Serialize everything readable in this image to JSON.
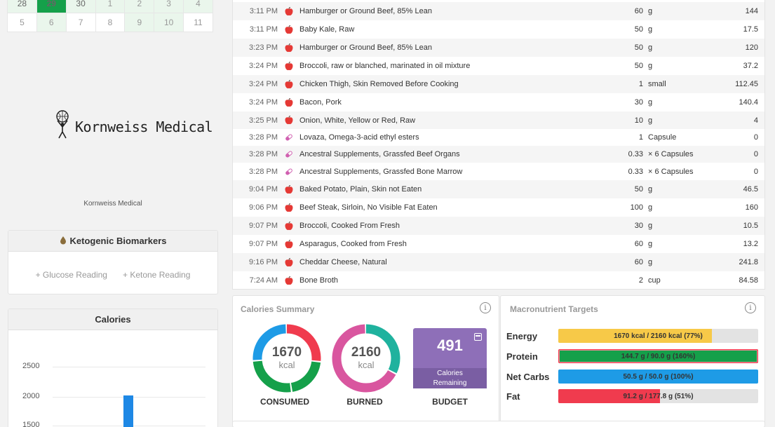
{
  "calendar": {
    "rows": [
      [
        {
          "d": "28",
          "s": "g"
        },
        {
          "d": "29",
          "s": "sel"
        },
        {
          "d": "30",
          "s": "g"
        },
        {
          "d": "1",
          "s": "g"
        },
        {
          "d": "2",
          "s": "g"
        },
        {
          "d": "3",
          "s": "g"
        },
        {
          "d": "4",
          "s": "g"
        }
      ],
      [
        {
          "d": "5",
          "s": ""
        },
        {
          "d": "6",
          "s": "g"
        },
        {
          "d": "7",
          "s": ""
        },
        {
          "d": "8",
          "s": ""
        },
        {
          "d": "9",
          "s": "g"
        },
        {
          "d": "10",
          "s": "g"
        },
        {
          "d": "11",
          "s": ""
        }
      ]
    ]
  },
  "logo": {
    "text": "Kornweiss Medical",
    "caption": "Kornweiss Medical"
  },
  "biomarkers": {
    "title": "Ketogenic Biomarkers",
    "glucose_link": "+ Glucose Reading",
    "ketone_link": "+ Ketone Reading"
  },
  "calories_panel": {
    "title": "Calories",
    "yticks": [
      "2500",
      "2000",
      "1500"
    ]
  },
  "food_log": [
    {
      "time": "3:11 PM",
      "icon": "food",
      "name": "Hamburger or Ground Beef, 85% Lean",
      "amount": "60",
      "unit": "g",
      "value": "144"
    },
    {
      "time": "3:11 PM",
      "icon": "food",
      "name": "Baby Kale, Raw",
      "amount": "50",
      "unit": "g",
      "value": "17.5"
    },
    {
      "time": "3:23 PM",
      "icon": "food",
      "name": "Hamburger or Ground Beef, 85% Lean",
      "amount": "50",
      "unit": "g",
      "value": "120"
    },
    {
      "time": "3:24 PM",
      "icon": "food",
      "name": "Broccoli, raw or blanched, marinated in oil mixture",
      "amount": "50",
      "unit": "g",
      "value": "37.2"
    },
    {
      "time": "3:24 PM",
      "icon": "food",
      "name": "Chicken Thigh, Skin Removed Before Cooking",
      "amount": "1",
      "unit": "small",
      "value": "112.45"
    },
    {
      "time": "3:24 PM",
      "icon": "food",
      "name": "Bacon, Pork",
      "amount": "30",
      "unit": "g",
      "value": "140.4"
    },
    {
      "time": "3:25 PM",
      "icon": "food",
      "name": "Onion, White, Yellow or Red, Raw",
      "amount": "10",
      "unit": "g",
      "value": "4"
    },
    {
      "time": "3:28 PM",
      "icon": "supplement",
      "name": "Lovaza, Omega-3-acid ethyl esters",
      "amount": "1",
      "unit": "Capsule",
      "value": "0"
    },
    {
      "time": "3:28 PM",
      "icon": "supplement",
      "name": "Ancestral Supplements, Grassfed Beef Organs",
      "amount": "0.33",
      "unit": "× 6 Capsules",
      "value": "0"
    },
    {
      "time": "3:28 PM",
      "icon": "supplement",
      "name": "Ancestral Supplements, Grassfed Bone Marrow",
      "amount": "0.33",
      "unit": "× 6 Capsules",
      "value": "0"
    },
    {
      "time": "9:04 PM",
      "icon": "food",
      "name": "Baked Potato, Plain, Skin not Eaten",
      "amount": "50",
      "unit": "g",
      "value": "46.5"
    },
    {
      "time": "9:06 PM",
      "icon": "food",
      "name": "Beef Steak, Sirloin, No Visible Fat Eaten",
      "amount": "100",
      "unit": "g",
      "value": "160"
    },
    {
      "time": "9:07 PM",
      "icon": "food",
      "name": "Broccoli, Cooked From Fresh",
      "amount": "30",
      "unit": "g",
      "value": "10.5"
    },
    {
      "time": "9:07 PM",
      "icon": "food",
      "name": "Asparagus, Cooked from Fresh",
      "amount": "60",
      "unit": "g",
      "value": "13.2"
    },
    {
      "time": "9:16 PM",
      "icon": "food",
      "name": "Cheddar Cheese, Natural",
      "amount": "60",
      "unit": "g",
      "value": "241.8"
    },
    {
      "time": "7:24 AM",
      "icon": "food",
      "name": "Bone Broth",
      "amount": "2",
      "unit": "cup",
      "value": "84.58"
    }
  ],
  "calories_summary": {
    "title": "Calories Summary",
    "info_icon": "i",
    "consumed": {
      "value": "1670",
      "unit": "kcal",
      "label": "CONSUMED"
    },
    "burned": {
      "value": "2160",
      "unit": "kcal",
      "label": "BURNED"
    },
    "budget": {
      "value": "491",
      "label_line1": "Calories",
      "label_line2": "Remaining",
      "caption": "BUDGET"
    },
    "colors": {
      "red": "#f03b4e",
      "green": "#15a04a",
      "blue": "#1e9be6",
      "pink": "#d9569f",
      "teal": "#1fb29e",
      "purple": "#8e6fb8"
    }
  },
  "macro_targets": {
    "title": "Macronutrient Targets",
    "info_icon": "i",
    "rows": [
      {
        "name": "Energy",
        "text": "1670 kcal / 2160 kcal (77%)",
        "fraction": 0.77,
        "color": "#f7c948",
        "outline": ""
      },
      {
        "name": "Protein",
        "text": "144.7 g / 90.0 g (160%)",
        "fraction": 1.0,
        "color": "#15a04a",
        "outline": "#f03b4e"
      },
      {
        "name": "Net Carbs",
        "text": "50.5 g / 50.0 g (100%)",
        "fraction": 1.0,
        "color": "#1e9be6",
        "outline": ""
      },
      {
        "name": "Fat",
        "text": "91.2 g / 177.8 g (51%)",
        "fraction": 0.51,
        "color": "#f03b4e",
        "outline": ""
      }
    ]
  }
}
